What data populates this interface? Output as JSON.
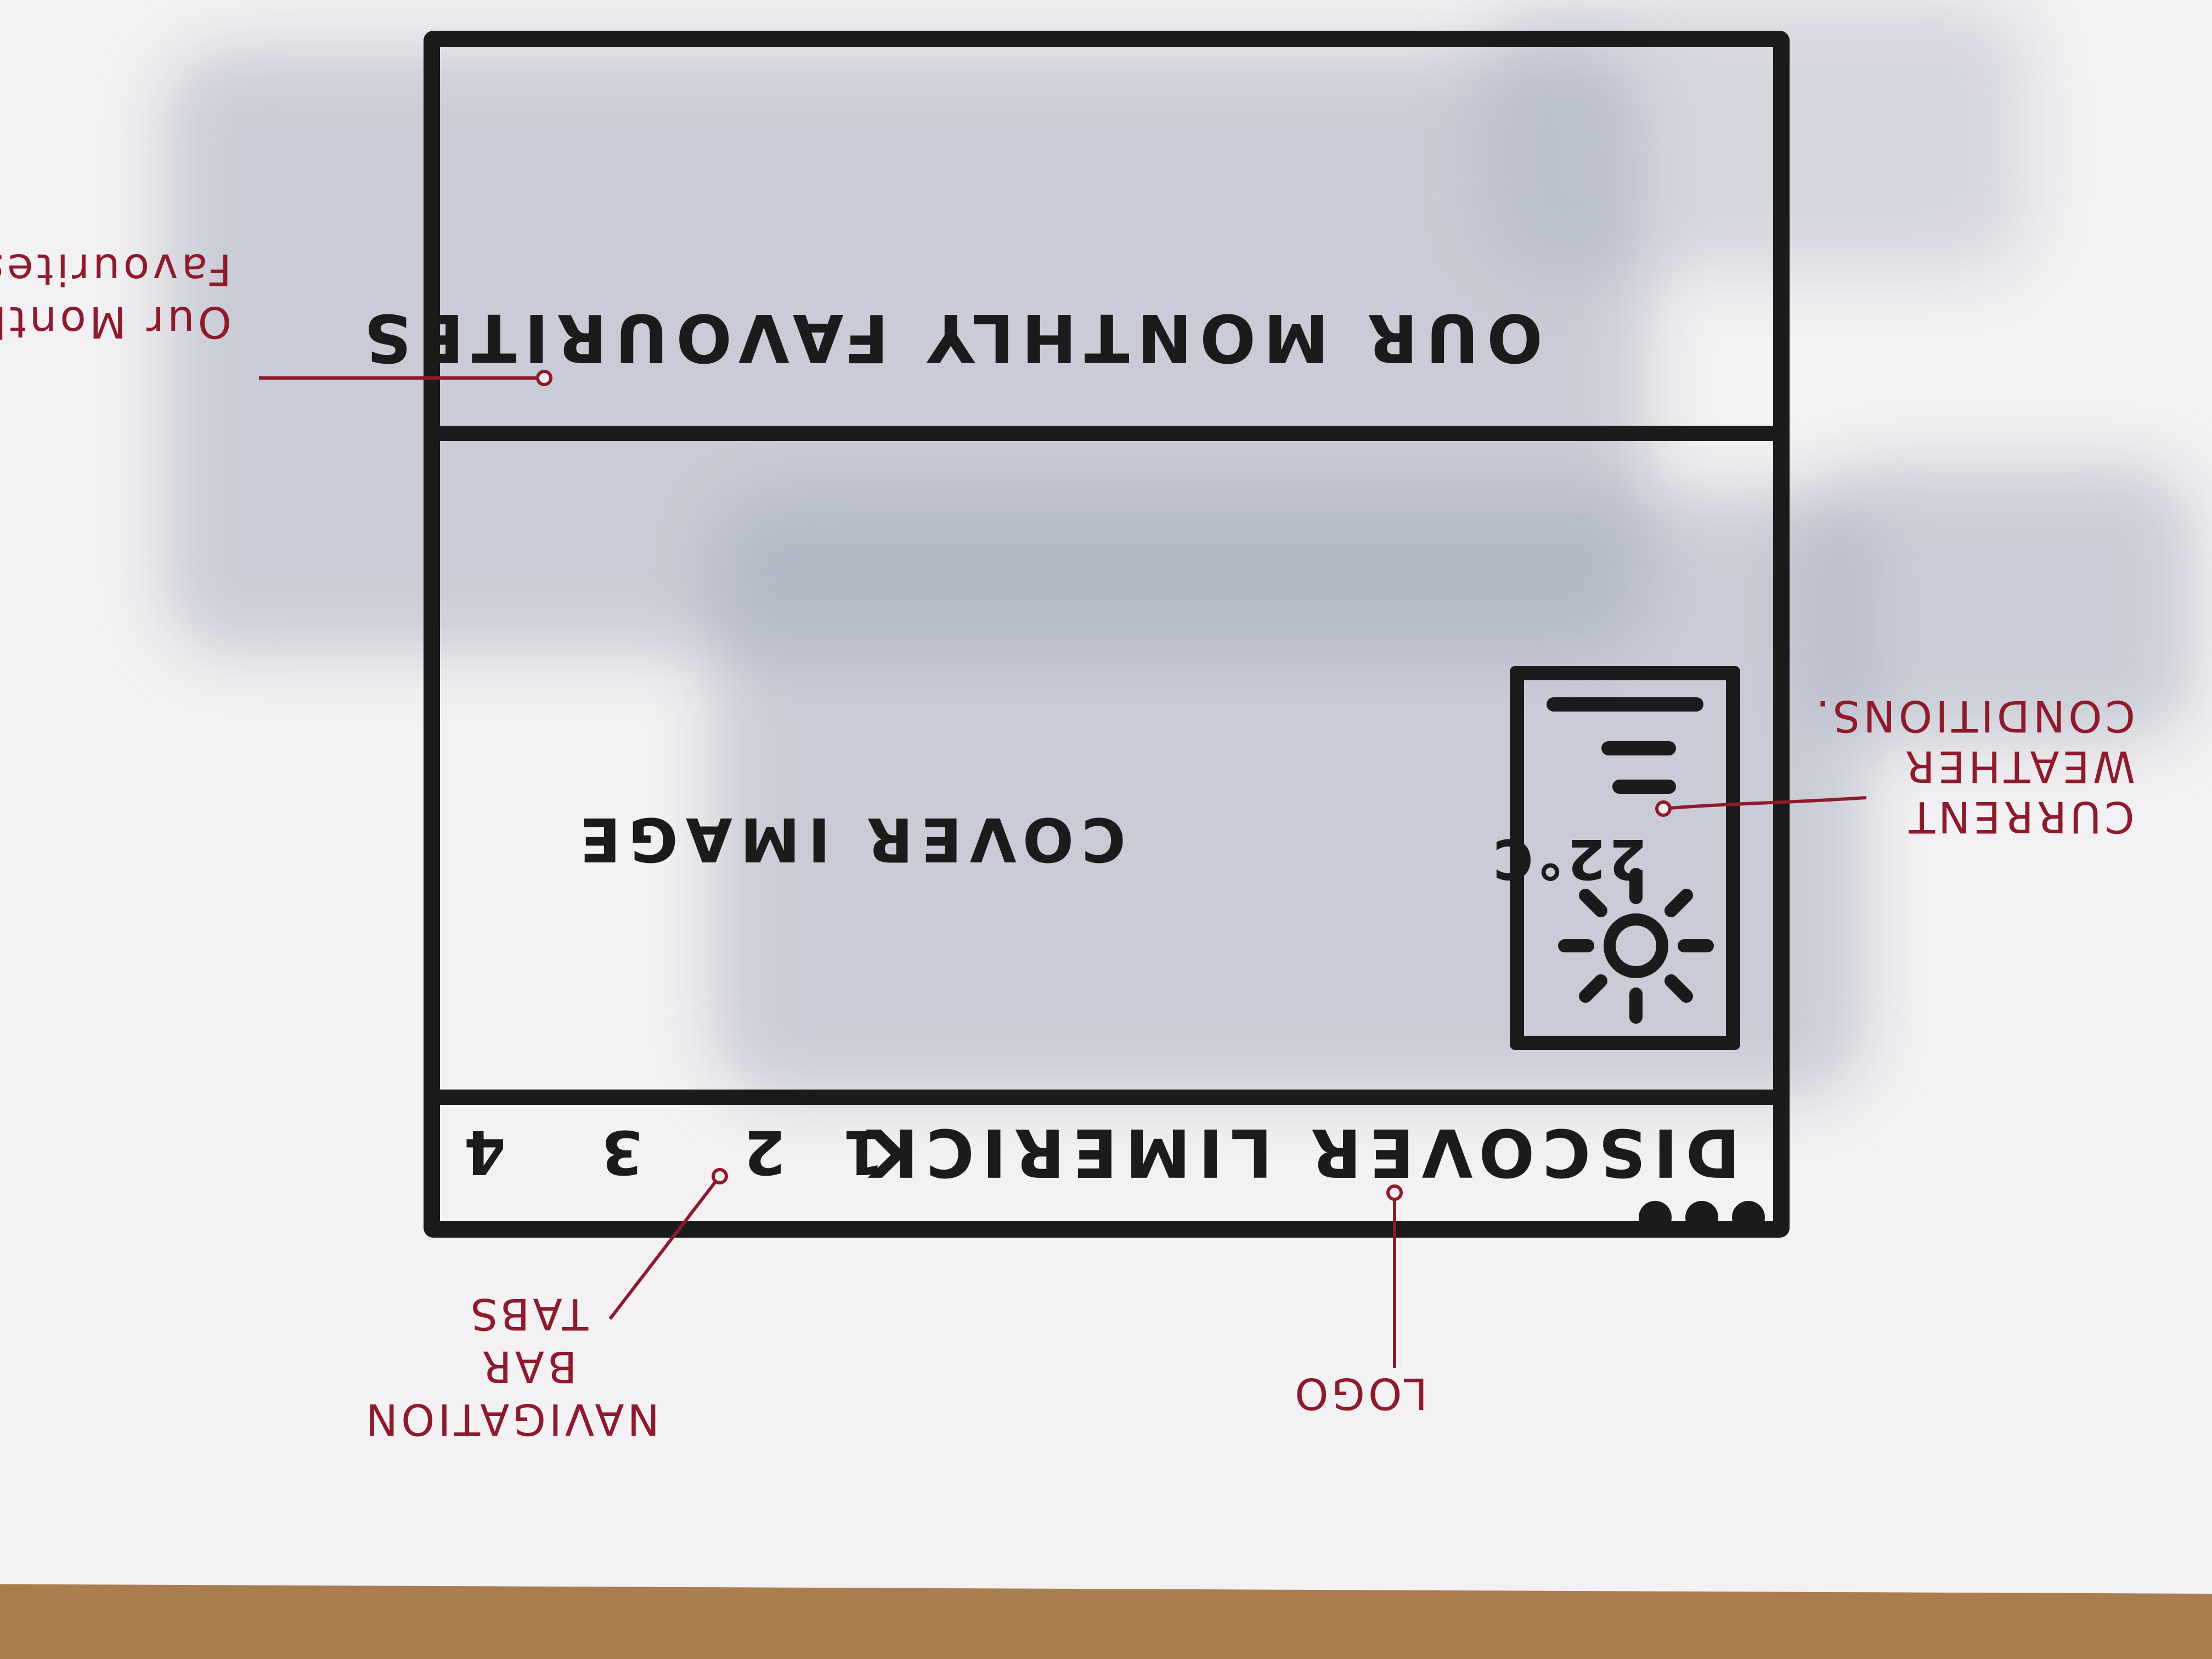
{
  "wireframe": {
    "title_bar": "OUR MONTHLY FAVOURITES",
    "cover_image": "COVER IMAGE",
    "logo": "DISCOVER LIMERICK",
    "nav_tabs": [
      "1",
      "2",
      "3",
      "4"
    ],
    "weather": {
      "temperature": "22°C",
      "icon": "sun-icon"
    }
  },
  "annotations": {
    "title": [
      "Our Monthly",
      "Favourites"
    ],
    "weather": [
      "CURRENT",
      "WEATHER",
      "CONDITIONS."
    ],
    "logo": "LOGO",
    "nav": [
      "NAVIGATION",
      "BAR",
      "TABS"
    ]
  },
  "colors": {
    "marker": "#1b1b1b",
    "annotation_pen": "#8e1a2c",
    "paper": "#f3f1f3",
    "desk": "#b48a5c"
  }
}
